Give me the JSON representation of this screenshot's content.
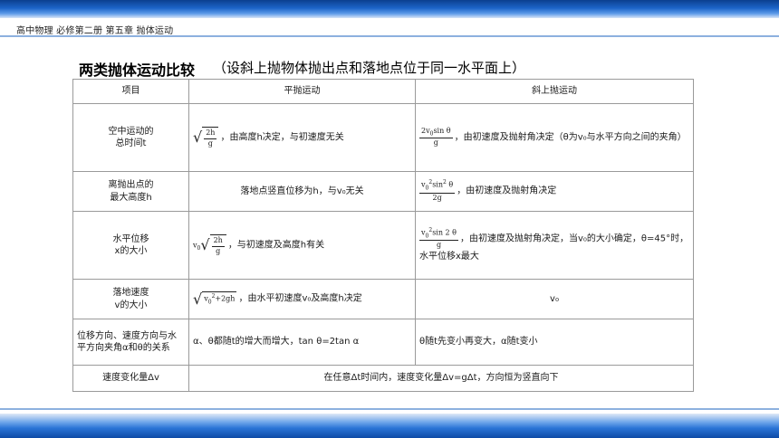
{
  "header": {
    "breadcrumb": "高中物理  必修第二册  第五章 抛体运动"
  },
  "title": "两类抛体运动比较",
  "subtitle": "（设斜上抛物体抛出点和落地点位于同一水平面上）",
  "table": {
    "headers": [
      "项目",
      "平抛运动",
      "斜上抛运动"
    ],
    "rows": [
      {
        "item": "空中运动的\n总时间t",
        "flat": "，由高度h决定，与初速度无关",
        "oblique": "，由初速度及抛射角决定（θ为v₀与水平方向之间的夹角）"
      },
      {
        "item": "离抛出点的\n最大高度h",
        "flat": "落地点竖直位移为h，与v₀无关",
        "oblique": "，由初速度及抛射角决定"
      },
      {
        "item": "水平位移\nx的大小",
        "flat": "，与初速度及高度h有关",
        "oblique": "，由初速度及抛射角决定，当v₀的大小确定，θ=45°时，水平位移x最大"
      },
      {
        "item": "落地速度\nv的大小",
        "flat": "，由水平初速度v₀及高度h决定",
        "oblique": "v₀"
      },
      {
        "item": "位移方向、速度方向与水平方向夹角α和θ的关系",
        "flat": "α、θ都随t的增大而增大，tan θ=2tan α",
        "oblique": "θ随t先变小再变大，α随t变小"
      },
      {
        "item": "速度变化量Δv",
        "merged": "在任意Δt时间内，速度变化量Δv=gΔt，方向恒为竖直向下"
      }
    ]
  }
}
